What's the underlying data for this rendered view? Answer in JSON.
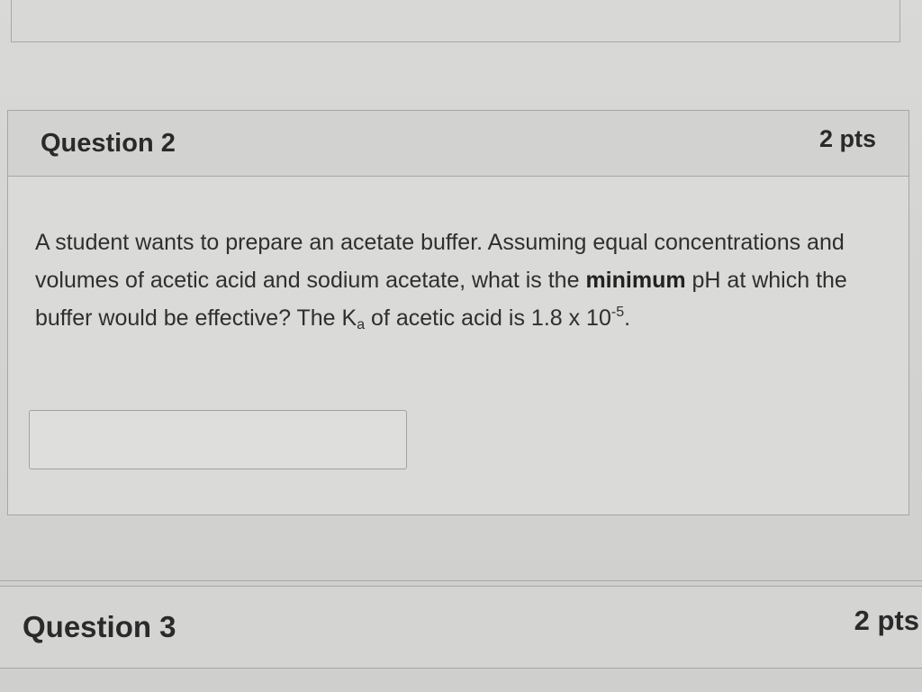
{
  "questions": [
    {
      "title": "Question 2",
      "points": "2 pts",
      "text_parts": {
        "p1": "A student wants to prepare an acetate buffer. Assuming equal concentrations and volumes of acetic acid and sodium acetate, what is the ",
        "bold": "minimum",
        "p2": " pH at which the buffer would be effective? The K",
        "sub": "a",
        "p3": " of acetic acid is 1.8 x 10",
        "sup": "-5",
        "p4": "."
      },
      "answer": {
        "value": "",
        "placeholder": ""
      }
    },
    {
      "title": "Question 3",
      "points": "2 pts"
    }
  ]
}
